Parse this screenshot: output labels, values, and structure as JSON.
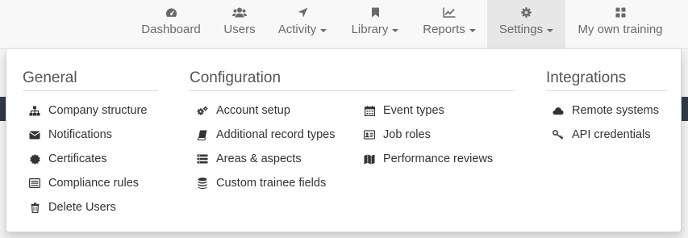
{
  "nav": {
    "items": [
      {
        "label": "Dashboard",
        "icon": "dashboard-icon",
        "caret": false
      },
      {
        "label": "Users",
        "icon": "users-icon",
        "caret": false
      },
      {
        "label": "Activity",
        "icon": "location-arrow-icon",
        "caret": true
      },
      {
        "label": "Library",
        "icon": "bookmark-icon",
        "caret": true
      },
      {
        "label": "Reports",
        "icon": "line-chart-icon",
        "caret": true
      },
      {
        "label": "Settings",
        "icon": "gear-icon",
        "caret": true,
        "active": true
      },
      {
        "label": "My own training",
        "icon": "grid-icon",
        "caret": false
      }
    ]
  },
  "settings_menu": {
    "general": {
      "title": "General",
      "items": [
        {
          "label": "Company structure",
          "icon": "sitemap-icon"
        },
        {
          "label": "Notifications",
          "icon": "envelope-icon"
        },
        {
          "label": "Certificates",
          "icon": "certificate-icon"
        },
        {
          "label": "Compliance rules",
          "icon": "list-alt-icon"
        },
        {
          "label": "Delete Users",
          "icon": "trash-icon"
        }
      ]
    },
    "configuration": {
      "title": "Configuration",
      "items": [
        {
          "label": "Account setup",
          "icon": "cogs-icon"
        },
        {
          "label": "Additional record types",
          "icon": "book-icon"
        },
        {
          "label": "Areas & aspects",
          "icon": "list-icon"
        },
        {
          "label": "Custom trainee fields",
          "icon": "database-icon"
        },
        {
          "label": "Event types",
          "icon": "calendar-icon"
        },
        {
          "label": "Job roles",
          "icon": "id-card-icon"
        },
        {
          "label": "Performance reviews",
          "icon": "map-icon"
        }
      ]
    },
    "integrations": {
      "title": "Integrations",
      "items": [
        {
          "label": "Remote systems",
          "icon": "cloud-icon"
        },
        {
          "label": "API credentials",
          "icon": "key-icon"
        }
      ]
    }
  },
  "colors": {
    "navbar_bg": "#f8f8f8",
    "active_tab_bg": "#e7e7e7",
    "dark_band": "#2f3b49"
  }
}
